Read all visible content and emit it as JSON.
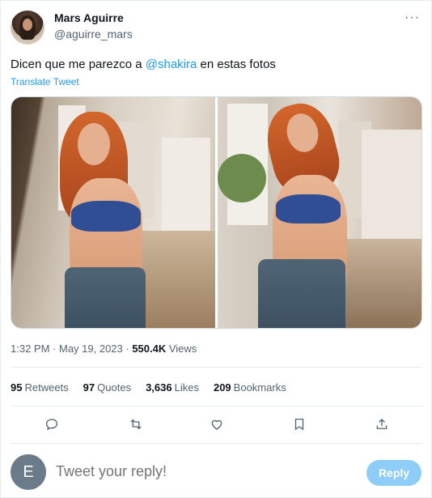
{
  "author": {
    "name": "Mars Aguirre",
    "handle": "@aguirre_mars",
    "more_label": "···"
  },
  "tweet": {
    "text_before": "Dicen que me parezco a ",
    "mention": "@shakira",
    "text_after": " en estas fotos",
    "translate_label": "Translate Tweet",
    "photo_count": 2
  },
  "meta": {
    "time": "1:32 PM",
    "separator": " · ",
    "date": "May 19, 2023",
    "views_count": "550.4K",
    "views_label": " Views"
  },
  "stats": [
    {
      "count": "95",
      "label": "Retweets"
    },
    {
      "count": "97",
      "label": "Quotes"
    },
    {
      "count": "3,636",
      "label": "Likes"
    },
    {
      "count": "209",
      "label": "Bookmarks"
    }
  ],
  "actions": [
    "reply-icon",
    "retweet-icon",
    "like-icon",
    "bookmark-icon",
    "share-icon"
  ],
  "reply": {
    "avatar_letter": "E",
    "placeholder": "Tweet your reply!",
    "button_label": "Reply"
  },
  "colors": {
    "accent": "#1d9bf0",
    "reply_button_disabled": "#8ecdf8",
    "muted_text": "#536471"
  }
}
